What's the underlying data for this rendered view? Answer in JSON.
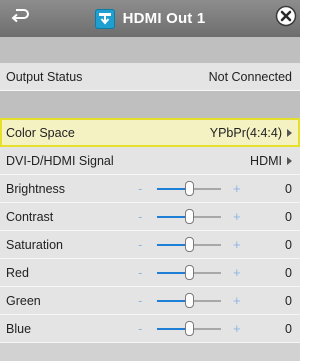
{
  "titlebar": {
    "title": "HDMI Out 1",
    "back_icon": "back-arrow-icon",
    "title_icon": "output-download-icon",
    "close_icon": "close-icon"
  },
  "rows": {
    "output_status": {
      "label": "Output Status",
      "value": "Not Connected"
    },
    "color_space": {
      "label": "Color Space",
      "value": "YPbPr(4:4:4)"
    },
    "dvi_signal": {
      "label": "DVI-D/HDMI Signal",
      "value": "HDMI"
    }
  },
  "sliders": [
    {
      "label": "Brightness",
      "value": "0",
      "minus": "-",
      "plus": "+",
      "level": 0.5
    },
    {
      "label": "Contrast",
      "value": "0",
      "minus": "-",
      "plus": "+",
      "level": 0.5
    },
    {
      "label": "Saturation",
      "value": "0",
      "minus": "-",
      "plus": "+",
      "level": 0.5
    },
    {
      "label": "Red",
      "value": "0",
      "minus": "-",
      "plus": "+",
      "level": 0.5
    },
    {
      "label": "Green",
      "value": "0",
      "minus": "-",
      "plus": "+",
      "level": 0.5
    },
    {
      "label": "Blue",
      "value": "0",
      "minus": "-",
      "plus": "+",
      "level": 0.5
    }
  ],
  "colors": {
    "titlebar": "#7d7d7d",
    "accent": "#1f9fd0",
    "selected_border": "#e6df2c",
    "slider_fill": "#1f7fd6"
  }
}
